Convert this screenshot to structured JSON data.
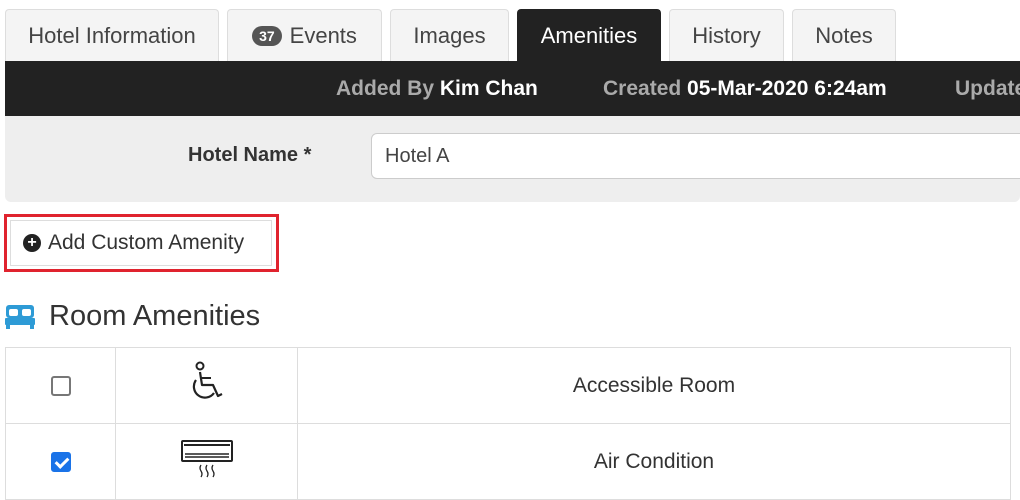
{
  "tabs": [
    {
      "label": "Hotel Information"
    },
    {
      "label": "Events",
      "badge": "37"
    },
    {
      "label": "Images"
    },
    {
      "label": "Amenities",
      "active": true
    },
    {
      "label": "History"
    },
    {
      "label": "Notes"
    }
  ],
  "meta": {
    "added_by_label": "Added By",
    "added_by_value": "Kim Chan",
    "created_label": "Created",
    "created_value": "05-Mar-2020 6:24am",
    "updated_label": "Update"
  },
  "form": {
    "hotel_name_label": "Hotel Name *",
    "hotel_name_value": "Hotel A"
  },
  "add_custom_amenity_label": "Add Custom Amenity",
  "section": {
    "title": "Room Amenities",
    "icon": "bed-icon"
  },
  "amenities": [
    {
      "name": "Accessible Room",
      "checked": false,
      "icon": "wheelchair-icon"
    },
    {
      "name": "Air Condition",
      "checked": true,
      "icon": "air-conditioner-icon"
    }
  ],
  "colors": {
    "header_bg": "#222222",
    "highlight": "#e0232e",
    "checkbox_checked": "#1a73e8",
    "bed_icon": "#2e9bd6"
  }
}
